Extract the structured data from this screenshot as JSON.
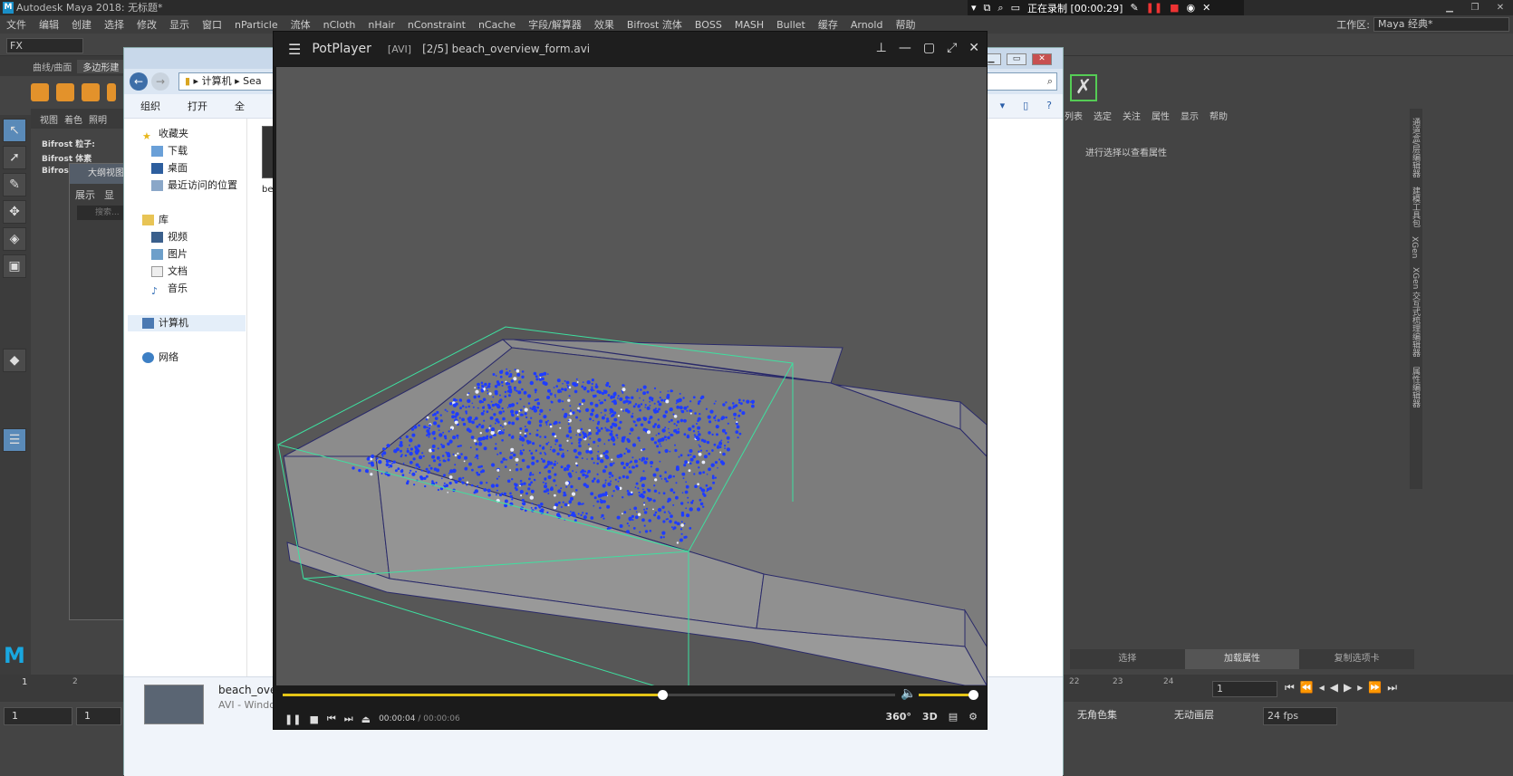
{
  "maya": {
    "title": "Autodesk Maya 2018: 无标题*",
    "logo": "M",
    "menu": [
      "文件",
      "编辑",
      "创建",
      "选择",
      "修改",
      "显示",
      "窗口",
      "nParticle",
      "流体",
      "nCloth",
      "nHair",
      "nConstraint",
      "nCache",
      "字段/解算器",
      "效果",
      "Bifrost 流体",
      "BOSS",
      "MASH",
      "Bullet",
      "缓存",
      "Arnold",
      "帮助"
    ],
    "workspace_label": "工作区:",
    "workspace_value": "Maya 经典*",
    "menuset": "FX",
    "shelf_tabs": [
      "曲线/曲面",
      "多边形建"
    ],
    "panel_menu": [
      "视图",
      "着色",
      "照明"
    ],
    "bifrost_items": [
      "Bifrost 粒子:",
      "Bifrost 体素",
      "Bifros"
    ],
    "outliner_title": "大纲视图",
    "outliner_menu": [
      "展示",
      "显"
    ],
    "outliner_search": "搜索...",
    "attr_tabs": [
      "列表",
      "选定",
      "关注",
      "属性",
      "显示",
      "帮助"
    ],
    "attr_message": "进行选择以查看属性",
    "attr_bottom": [
      "选择",
      "加载属性",
      "复制选项卡"
    ],
    "side_tabs": [
      "通道盒/层编辑器",
      "建模工具包",
      "XGen",
      "XGen 交互式梳理编辑器",
      "属性编辑器"
    ],
    "timeline_ticks": [
      "1",
      "2",
      "22",
      "23",
      "24"
    ],
    "current_frame": "1",
    "range_start": "1",
    "range_inner": "1",
    "char_set": "无角色集",
    "anim_layer": "无动画层",
    "fps": "24 fps"
  },
  "recorder": {
    "status": "正在录制 [00:00:29]"
  },
  "explorer": {
    "address": [
      "计算机",
      "Sea"
    ],
    "commands": [
      "组织",
      "打开",
      "全"
    ],
    "favorites_header": "收藏夹",
    "favorites": [
      "下载",
      "桌面",
      "最近访问的位置"
    ],
    "library_header": "库",
    "libraries": [
      "视频",
      "图片",
      "文档",
      "音乐"
    ],
    "computer": "计算机",
    "network": "网络",
    "file_label": "be",
    "detail_name": "beach_overv",
    "detail_type": "AVI - Window"
  },
  "potplayer": {
    "brand": "PotPlayer",
    "format": "[AVI]",
    "file": "[2/5]  beach_overview_form.avi",
    "time_current": "00:00:04",
    "time_total": "00:00:06",
    "progress": 0.62,
    "volume": 1.0,
    "btn_360": "360°",
    "btn_3d": "3D"
  },
  "colors": {
    "seek": "#e5c516",
    "particles": "#1f3cff",
    "bbox": "#3ee0a0"
  }
}
